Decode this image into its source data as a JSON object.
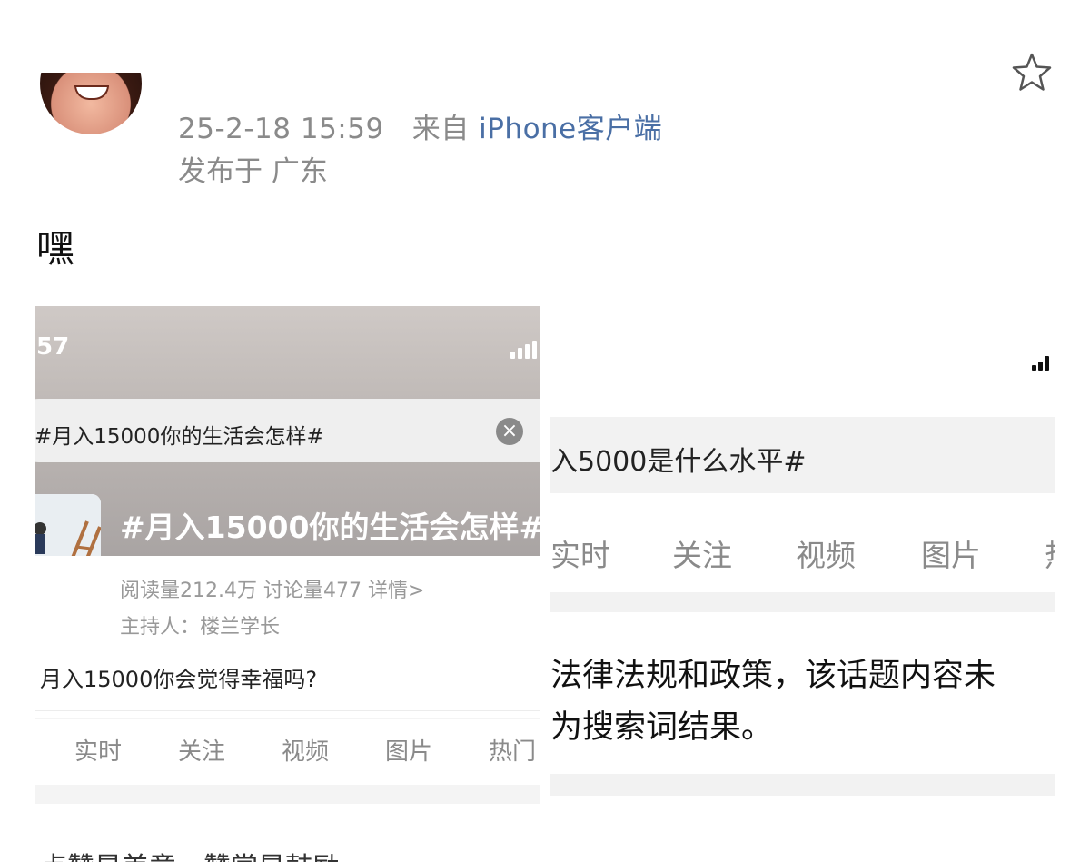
{
  "post": {
    "favorite_icon": "star-outline-icon",
    "time": "25-2-18 15:59",
    "source_prefix": "来自",
    "source": "iPhone客户端",
    "location": "发布于 广东",
    "text": "嘿",
    "footer_text": "点赞是美意，赞赏是鼓励"
  },
  "left_screenshot": {
    "status_time": "57",
    "search_value": "#月入15000你的生活会怎样#",
    "topic_title": "#月入15000你的生活会怎样#",
    "stats": "阅读量212.4万  讨论量477  详情>",
    "host": "主持人：楼兰学长",
    "question": "月入15000你会觉得幸福吗?",
    "tabs": [
      "实时",
      "关注",
      "视频",
      "图片",
      "热门"
    ]
  },
  "right_screenshot": {
    "search_value": "入5000是什么水平#",
    "tabs": [
      "实时",
      "关注",
      "视频",
      "图片",
      "热"
    ],
    "notice_line1": "法律法规和政策，该话题内容未",
    "notice_line2": "为搜索词结果。"
  }
}
